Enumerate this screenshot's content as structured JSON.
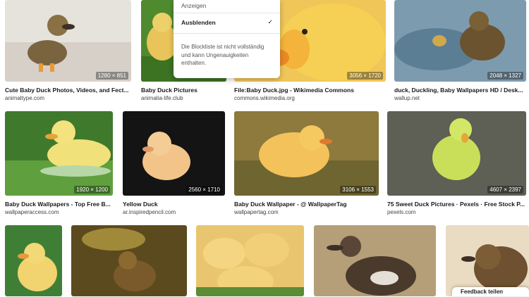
{
  "menu": {
    "show_label": "Anzeigen",
    "hide_label": "Ausblenden",
    "check_mark": "✓",
    "note": "Die Blockliste ist nicht vollständig und kann Ungenauigkeiten enthalten."
  },
  "row1": [
    {
      "title": "Cute Baby Duck Photos, Videos, and Fect...",
      "source": "animaltype.com",
      "dims": "1280 × 851"
    },
    {
      "title": "Baby Duck Pictures",
      "source": "animalia-life.club",
      "dims": ""
    },
    {
      "title": "File:Baby Duck.jpg - Wikimedia Commons",
      "source": "commons.wikimedia.org",
      "dims": "3056 × 1720"
    },
    {
      "title": "duck, Duckling, Baby Wallpapers HD / Desk...",
      "source": "wallup.net",
      "dims": "2048 × 1327"
    }
  ],
  "row2": [
    {
      "title": "Baby Duck Wallpapers - Top Free B...",
      "source": "wallpaperaccess.com",
      "dims": "1920 × 1200"
    },
    {
      "title": "Yellow Duck",
      "source": "ar.inspiredpencil.com",
      "dims": "2560 × 1710"
    },
    {
      "title": "Baby Duck Wallpaper - @ WallpaperTag",
      "source": "wallpapertag.com",
      "dims": "3106 × 1553"
    },
    {
      "title": "75 Sweet Duck Pictures · Pexels · Free Stock P...",
      "source": "pexels.com",
      "dims": "4607 × 2397"
    }
  ],
  "feedback_label": "Feedback teilen",
  "colors": {
    "menu_bg": "#ffffff",
    "title_text": "#1a1a1a",
    "source_text": "#444444"
  }
}
